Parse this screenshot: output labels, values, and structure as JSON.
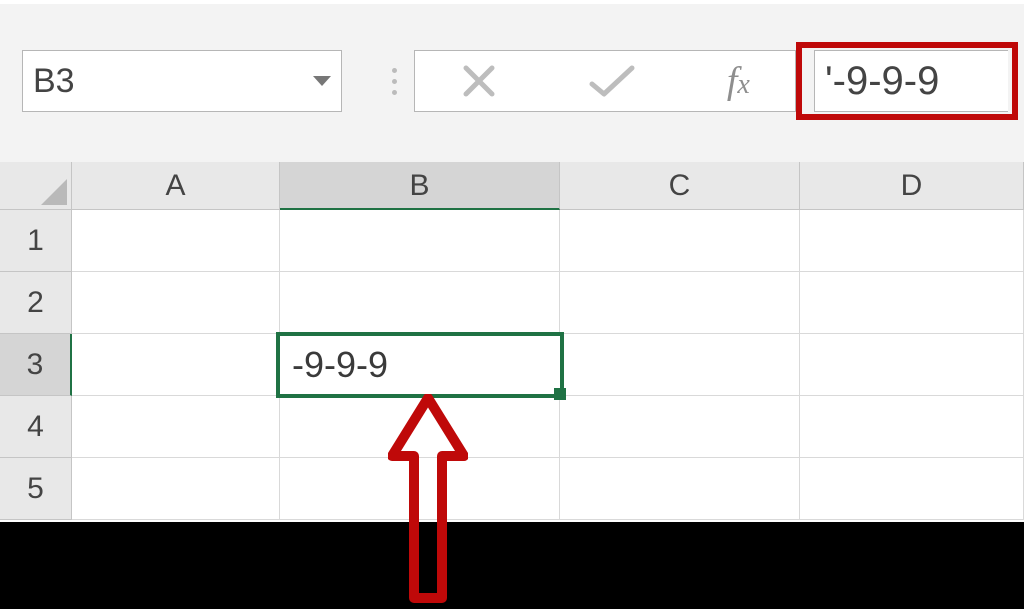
{
  "formula_bar": {
    "name_box": "B3",
    "formula_value": "'-9-9-9"
  },
  "columns": [
    "A",
    "B",
    "C",
    "D"
  ],
  "rows": [
    "1",
    "2",
    "3",
    "4",
    "5"
  ],
  "selected_cell": {
    "address": "B3",
    "display": "-9-9-9"
  },
  "colors": {
    "selection": "#1f7244",
    "highlight_box": "#bf0909"
  },
  "icons": {
    "dropdown": "chevron-down-icon",
    "cancel": "close-icon",
    "confirm": "check-icon",
    "fx": "fx-icon"
  }
}
